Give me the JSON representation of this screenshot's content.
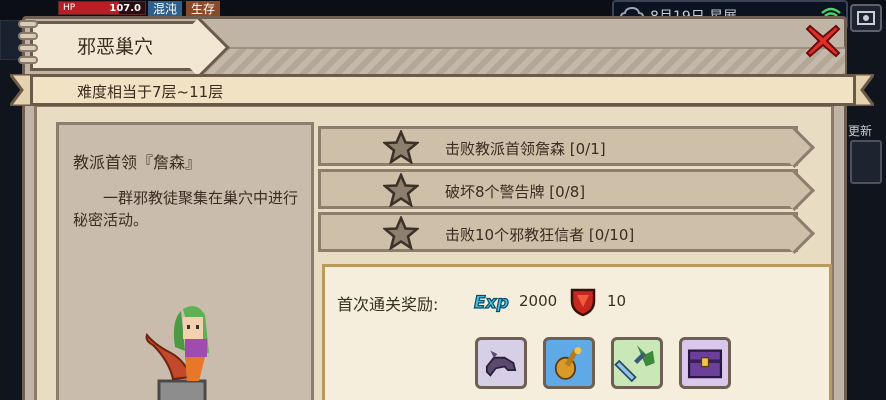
{
  "hud": {
    "hp_label": "HP",
    "hp_value": "107.0",
    "hp_fraction": 0.7,
    "tag_1": "混沌",
    "tag_2": "生存",
    "date": "8月19日 星展",
    "side_label": "更新"
  },
  "dungeon": {
    "title": "邪恶巢穴",
    "difficulty": "难度相当于7层~11层",
    "boss_name": "教派首领『詹森』",
    "boss_desc": "一群邪教徒聚集在巢穴中进行秘密活动。"
  },
  "objectives": [
    {
      "text": "击败教派首领詹森 [0/1]",
      "icon": "star-icon"
    },
    {
      "text": "破坏8个警告牌 [0/8]",
      "icon": "star-icon"
    },
    {
      "text": "击败10个邪教狂信者 [0/10]",
      "icon": "star-icon"
    }
  ],
  "rewards": {
    "label": "首次通关奖励:",
    "exp_value": "2000",
    "shield_value": "10",
    "items": [
      {
        "icon": "dragon-icon",
        "color": "#d6cfe6"
      },
      {
        "icon": "pipa-icon",
        "color": "#5fa9e6"
      },
      {
        "icon": "sword-icon",
        "color": "#c9e7b7"
      },
      {
        "icon": "chest-icon",
        "color": "#d9c8ec"
      }
    ]
  },
  "colors": {
    "panel": "#bfb4a6",
    "ribbon": "#f1e2c3",
    "close": "#e0302a"
  }
}
